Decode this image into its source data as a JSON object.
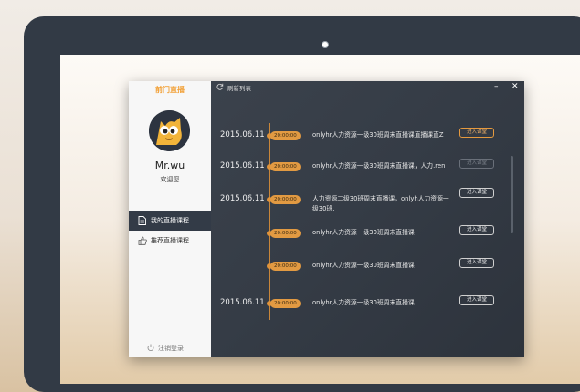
{
  "app": {
    "logo_text": "前门直播",
    "refresh_label": "刷新列表",
    "minimize_label": "–",
    "close_label": "✕"
  },
  "user": {
    "name": "Mr.wu",
    "welcome": "欢迎您"
  },
  "sidebar": {
    "items": [
      {
        "label": "我的直播课程",
        "active": true,
        "icon": "document-icon"
      },
      {
        "label": "推荐直播课程",
        "active": false,
        "icon": "thumbs-up-icon"
      }
    ],
    "logout_label": "注销登录"
  },
  "schedule": [
    {
      "date": "2015.06.11",
      "time": "20:00:00",
      "title": "onlyhr人力资源一级30班周末直播课直播课直Z",
      "button": "进入课堂",
      "button_state": "primary"
    },
    {
      "date": "2015.06.11",
      "time": "20:00:00",
      "title": "onlyhr人力资源一级30班周末直播课，人力.ren",
      "button": "进入课堂",
      "button_state": "disabled"
    },
    {
      "date": "2015.06.11",
      "time": "20:00:00",
      "title": "人力资源二级30班周末直播课，onlyh人力资源一级30班.",
      "button": "进入课堂",
      "button_state": "normal"
    },
    {
      "date": "",
      "time": "20:00:00",
      "title": "onlyhr人力资源一级30班周末直播课",
      "button": "进入课堂",
      "button_state": "normal"
    },
    {
      "date": "",
      "time": "20:00:00",
      "title": "onlyhr人力资源一级30班周末直播课",
      "button": "进入课堂",
      "button_state": "normal"
    },
    {
      "date": "2015.06.11",
      "time": "20:00:00",
      "title": "onlyhr人力资源一级30班周末直播课",
      "button": "进入课堂",
      "button_state": "normal"
    }
  ],
  "colors": {
    "accent": "#e29a42",
    "main_bg": "#363d47",
    "sidebar_bg": "#f7f7f7",
    "device_frame": "#323a45"
  }
}
